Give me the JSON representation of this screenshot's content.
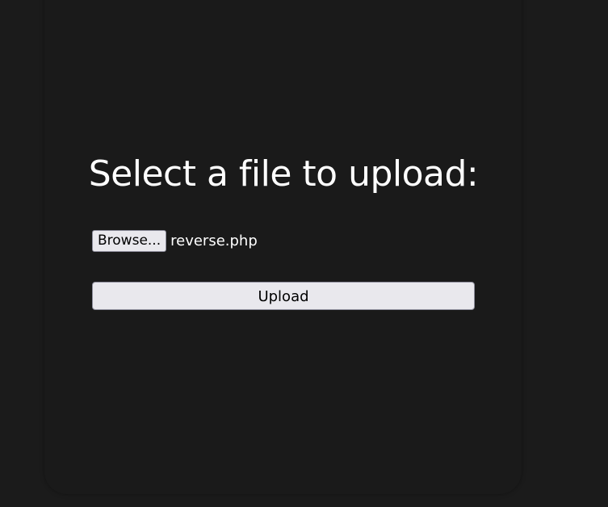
{
  "form": {
    "title": "Select a file to upload:",
    "browse_label": "Browse...",
    "selected_file": "reverse.php",
    "upload_label": "Upload"
  },
  "colors": {
    "background": "#1b1b1b",
    "title_text": "#ffffff",
    "button_background": "#e9e8ed",
    "button_border": "#8f8f9d"
  }
}
